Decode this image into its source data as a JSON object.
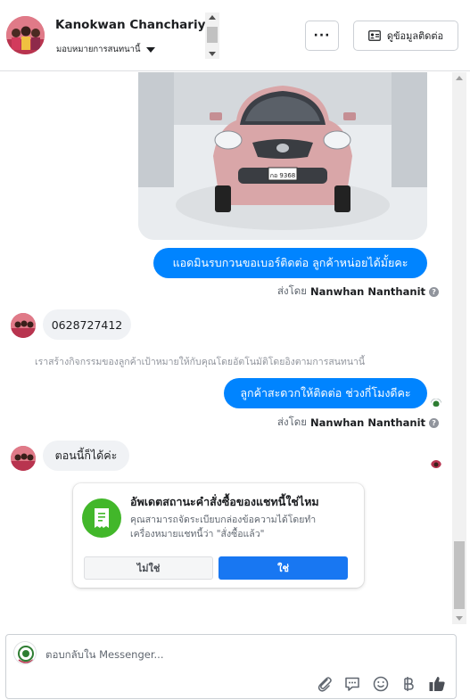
{
  "header": {
    "contact_name": "Kanokwan Chanchariyawt",
    "assign_label": "มอบหมายการสนทนานี้",
    "more_label": "···",
    "contact_info_label": "ดูข้อมูลติดต่อ"
  },
  "messages": {
    "outgoing_1": "แอดมินรบกวนขอเบอร์ติดต่อ ลูกค้าหน่อยได้มั้ยคะ",
    "sent_by_prefix_1": "ส่งโดย",
    "sent_by_name_1": "Nanwhan Nanthanit",
    "incoming_1": "0628727412",
    "system_note": "เราสร้างกิจกรรมของลูกค้าเป้าหมายให้กับคุณโดยอัตโนมัติโดยอิงตามการสนทนานี้",
    "outgoing_2": "ลูกค้าสะดวกให้ติดต่อ ช่วงกี่โมงดีคะ",
    "sent_by_prefix_2": "ส่งโดย",
    "sent_by_name_2": "Nanwhan Nanthanit",
    "incoming_2": "ตอนนี้ก็ได้ค่ะ",
    "car_plate": "กอ 9368"
  },
  "order_card": {
    "title": "อัพเดตสถานะคำสั่งซื้อของแชทนี้ใช่ไหม",
    "description": "คุณสามารถจัดระเบียบกล่องข้อความได้โดยทำเครื่องหมายแชทนี้ว่า \"สั่งซื้อแล้ว\"",
    "no_label": "ไม่ใช่",
    "yes_label": "ใช่"
  },
  "composer": {
    "placeholder": "ตอบกลับใน Messenger..."
  },
  "colors": {
    "accent_blue": "#0084ff",
    "button_blue": "#1877f2",
    "order_green": "#42b72a"
  }
}
